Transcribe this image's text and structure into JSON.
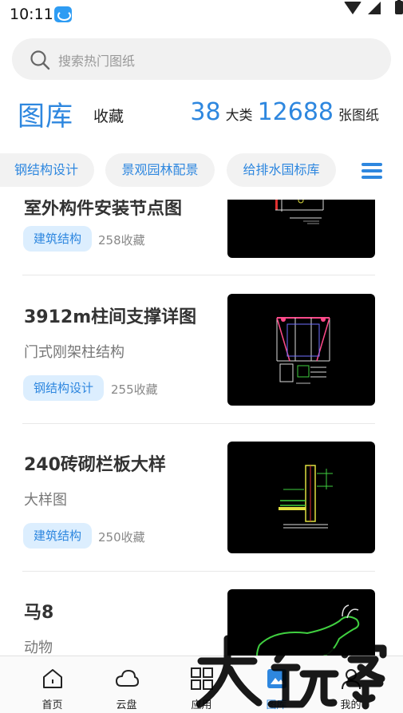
{
  "status_bar": {
    "time": "10:11"
  },
  "search": {
    "placeholder": "搜索热门图纸"
  },
  "header": {
    "title": "图库",
    "favorites": "收藏",
    "category_count": "38",
    "category_unit": "大类",
    "drawing_count": "12688",
    "drawing_unit": "张图纸"
  },
  "categories": {
    "items": [
      "钢结构设计",
      "景观园林配景",
      "给排水国标库"
    ]
  },
  "list": {
    "items": [
      {
        "title": "室外构件安装节点图",
        "tag": "建筑结构",
        "favorites": "258收藏"
      },
      {
        "title": "3912m柱间支撑详图",
        "subtitle": "门式刚架柱结构",
        "tag": "钢结构设计",
        "favorites": "255收藏"
      },
      {
        "title": "240砖砌栏板大样",
        "subtitle": "大样图",
        "tag": "建筑结构",
        "favorites": "250收藏"
      },
      {
        "title": "马8",
        "subtitle": "动物"
      }
    ]
  },
  "bottom_nav": {
    "items": [
      {
        "label": "首页"
      },
      {
        "label": "云盘"
      },
      {
        "label": "应用"
      },
      {
        "label": "图库"
      },
      {
        "label": "我的"
      }
    ]
  },
  "watermark": {
    "text": "大玩家"
  },
  "colors": {
    "accent": "#2e87df",
    "tag_bg": "#dceefe"
  }
}
